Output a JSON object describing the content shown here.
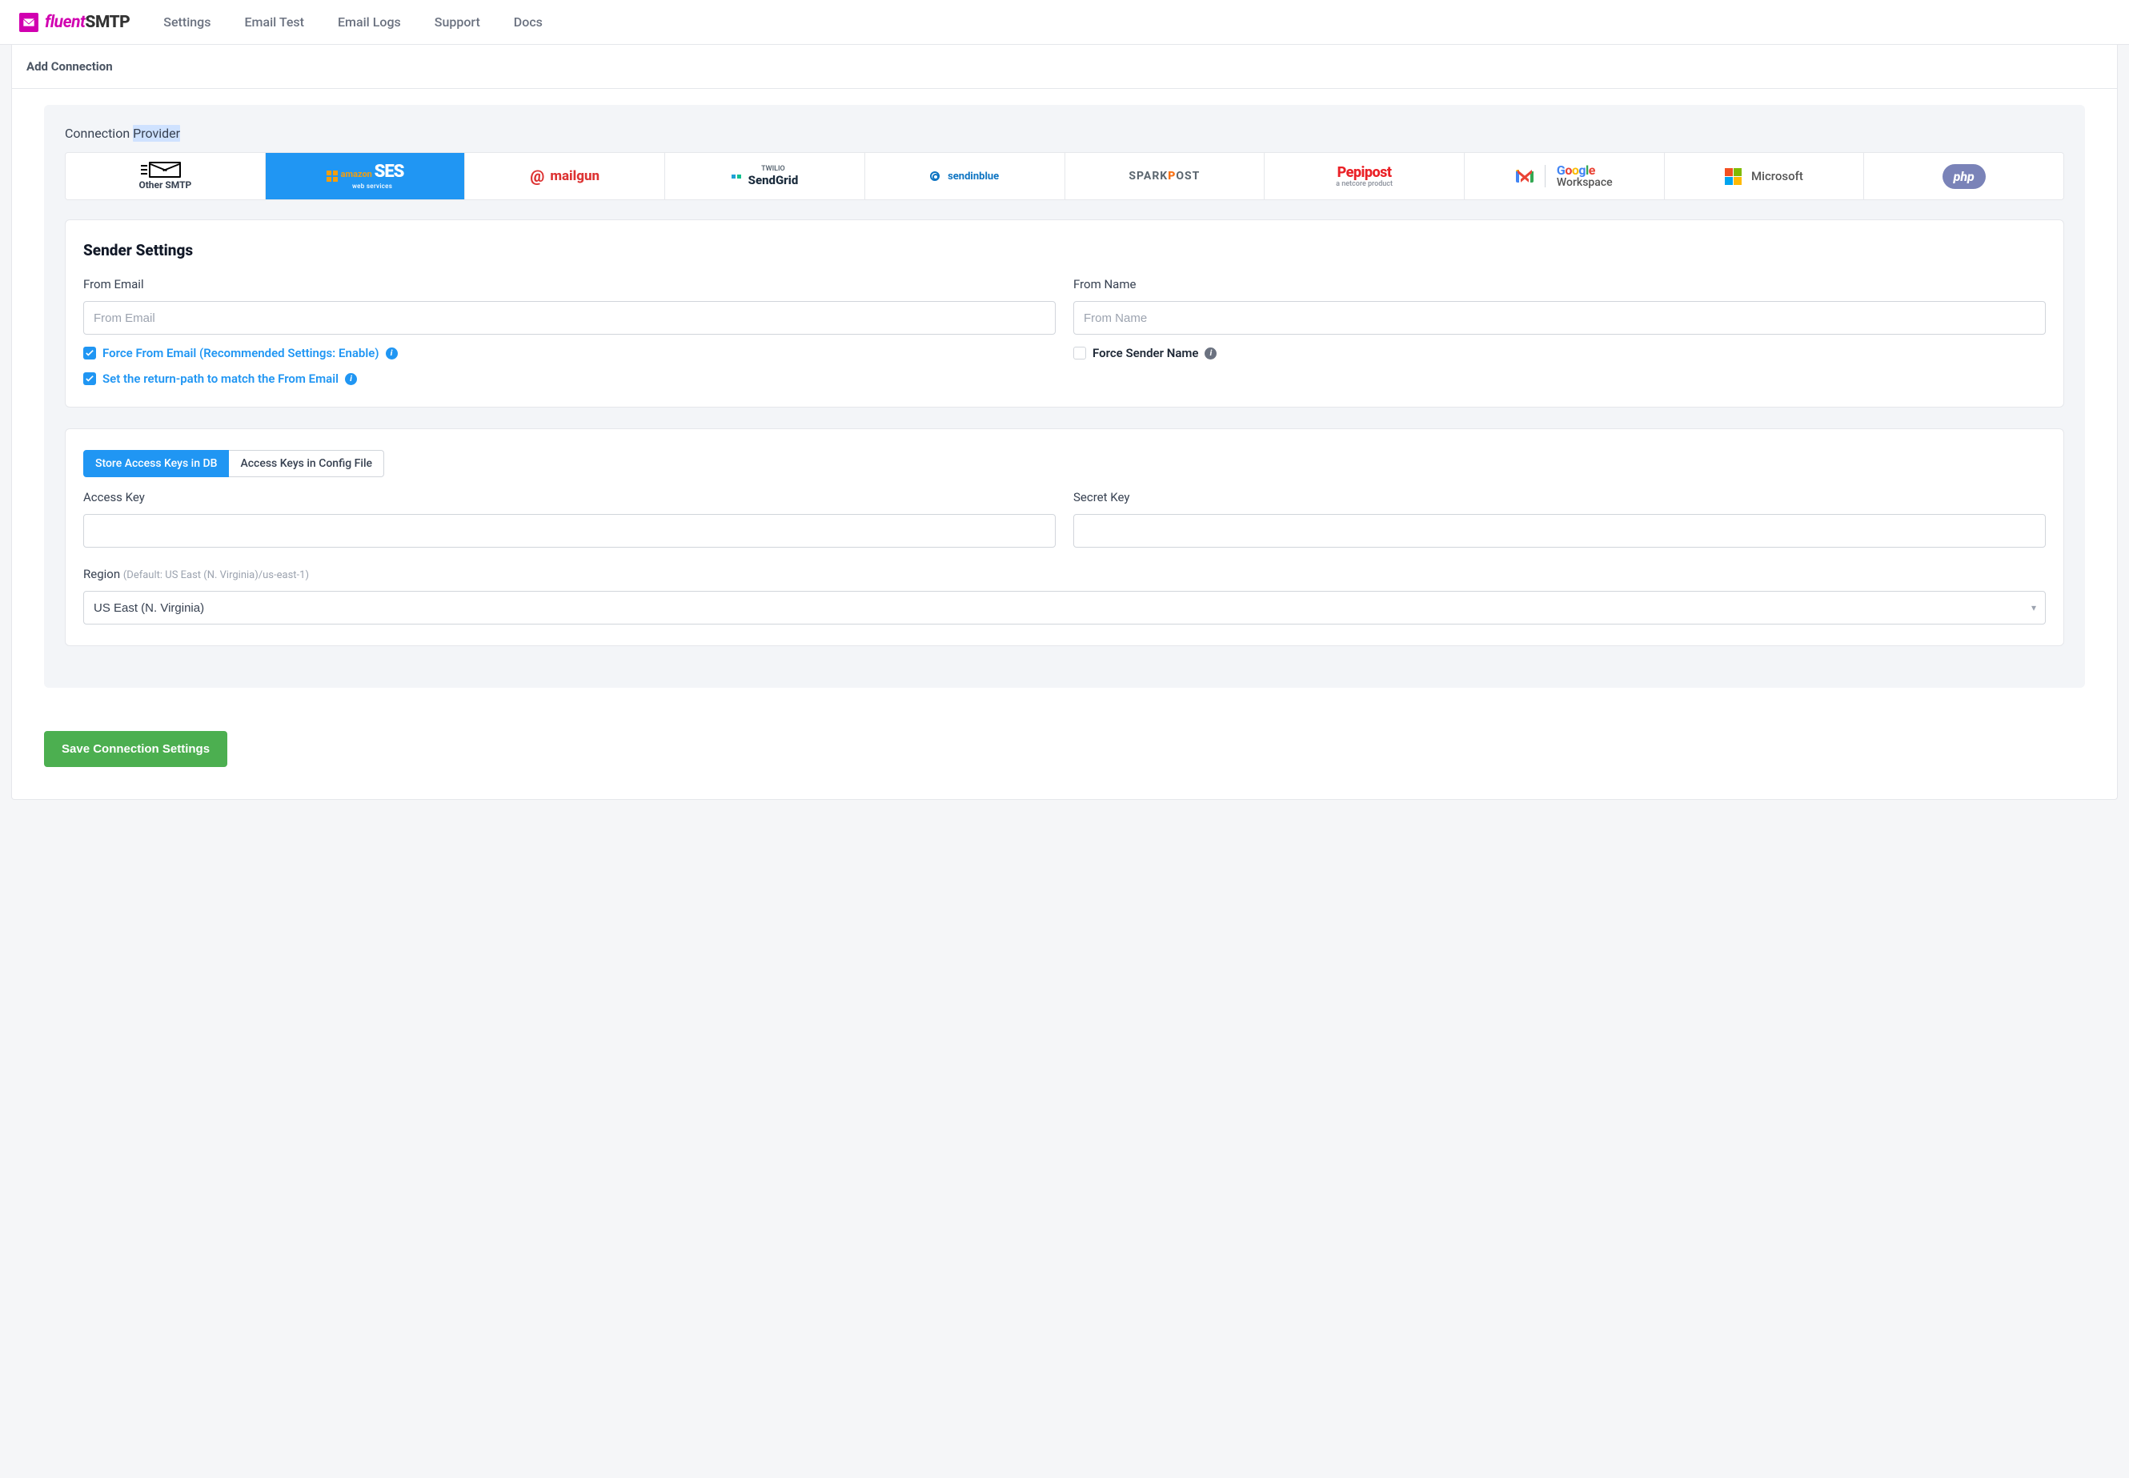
{
  "brand": {
    "fluent": "fluent",
    "smtp": "SMTP"
  },
  "nav": {
    "settings": "Settings",
    "emailTest": "Email Test",
    "emailLogs": "Email Logs",
    "support": "Support",
    "docs": "Docs"
  },
  "page": {
    "title": "Add Connection"
  },
  "section": {
    "conn": "Connection ",
    "provider": "Provider"
  },
  "providers": {
    "otherSmtp": "Other SMTP",
    "sesAmazon": "amazon",
    "sesSub": "web services",
    "sesBig": "SES",
    "mailgun": "mailgun",
    "sendgridPre": "TWILIO",
    "sendgrid": "SendGrid",
    "sendinblue": "sendinblue",
    "sparkpostA": "SPARK",
    "sparkpostB": "P",
    "sparkpostC": "OST",
    "pepipost": "Pepipost",
    "pepipostSub": "a netcore product",
    "google": "Google",
    "workspace": "Workspace",
    "microsoft": "Microsoft",
    "php": "php"
  },
  "sender": {
    "heading": "Sender Settings",
    "fromEmailLabel": "From Email",
    "fromEmailPH": "From Email",
    "fromNameLabel": "From Name",
    "fromNamePH": "From Name",
    "forceFromEmail": "Force From Email (Recommended Settings: Enable)",
    "returnPath": "Set the return-path to match the From Email",
    "forceSenderName": "Force Sender Name"
  },
  "keys": {
    "tabDb": "Store Access Keys in DB",
    "tabCfg": "Access Keys in Config File",
    "accessKey": "Access Key",
    "secretKey": "Secret Key",
    "region": "Region",
    "regionHint": "(Default: US East (N. Virginia)/us-east-1)",
    "regionValue": "US East (N. Virginia)"
  },
  "actions": {
    "save": "Save Connection Settings"
  }
}
